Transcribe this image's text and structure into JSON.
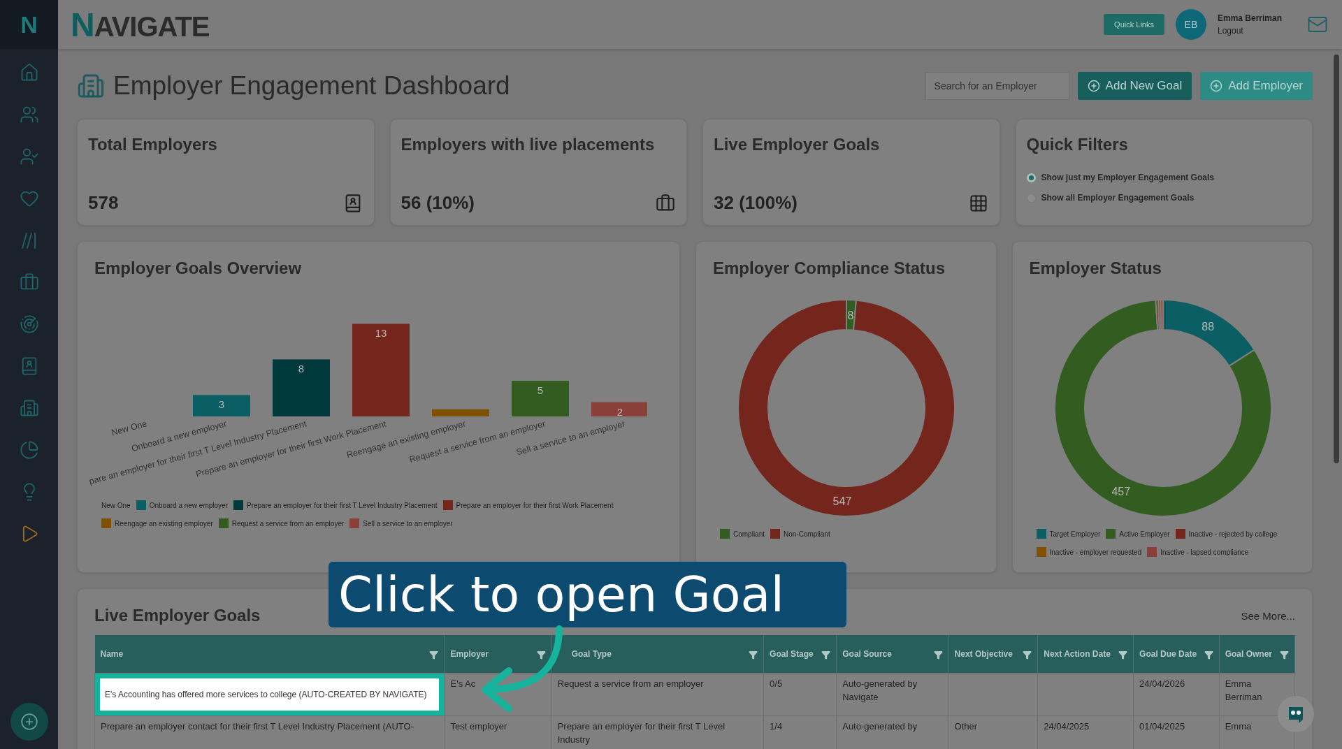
{
  "brand": {
    "logo": "NAVIGATE",
    "sidebar_mark": "N"
  },
  "header": {
    "quick_links": "Quick Links",
    "user": {
      "initials": "EB",
      "name": "Emma Berriman",
      "logout": "Logout"
    }
  },
  "sidebar": {
    "items": [
      {
        "kind": "home"
      },
      {
        "kind": "users"
      },
      {
        "kind": "user-tag"
      },
      {
        "kind": "heart"
      },
      {
        "kind": "slashes"
      },
      {
        "kind": "briefcase"
      },
      {
        "kind": "radar"
      },
      {
        "kind": "contact"
      },
      {
        "kind": "building"
      },
      {
        "kind": "pie"
      },
      {
        "kind": "bulb"
      },
      {
        "kind": "play"
      }
    ]
  },
  "page": {
    "title": "Employer Engagement Dashboard",
    "search": {
      "placeholder": "Search for an Employer"
    },
    "buttons": [
      "Add New Goal",
      "Add Employer"
    ]
  },
  "stats": [
    {
      "label": "Total Employers",
      "value": "578",
      "kind": "contact"
    },
    {
      "label": "Employers with live placements",
      "value": "56 (10%)",
      "kind": "briefcase"
    },
    {
      "label": "Live Employer Goals",
      "value": "32 (100%)",
      "kind": "grid"
    }
  ],
  "quick_filters": {
    "title": "Quick Filters",
    "options": [
      {
        "label": "Show just my Employer Engagement Goals",
        "selected": true
      },
      {
        "label": "Show all Employer Engagement Goals",
        "selected": false
      }
    ]
  },
  "goals_overview": {
    "title": "Employer Goals Overview",
    "chart_data": {
      "type": "bar",
      "categories": [
        "New One",
        "Onboard a new employer",
        "pare an employer for their first T Level Industry Placement",
        "Prepare an employer for their first Work Placement",
        "Reengage an existing employer",
        "Request a service from an employer",
        "Sell a service to an employer"
      ],
      "values": [
        0,
        3,
        8,
        13,
        1,
        5,
        2
      ],
      "value_labels": [
        null,
        "3",
        "8",
        "13",
        null,
        "5",
        "2"
      ]
    },
    "legend": [
      {
        "label": "New One"
      },
      {
        "label": "Onboard a new employer",
        "color": "#0b5e63"
      },
      {
        "label": "Prepare an employer for their first T Level Industry Placement",
        "color": "#003a3d"
      },
      {
        "label": "Prepare an employer for their first Work Placement",
        "color": "#74261d"
      },
      {
        "label": "Reengage an existing employer",
        "color": "#7f5100"
      },
      {
        "label": "Request a service from an employer",
        "color": "#335c20"
      },
      {
        "label": "Sell a service to an employer",
        "color": "#8a4038"
      }
    ]
  },
  "compliance": {
    "title": "Employer Compliance Status",
    "chart_data": {
      "type": "donut",
      "categories": [
        "Compliant",
        "Non-Compliant"
      ],
      "values": [
        8,
        547
      ],
      "colors": [
        "#335c20",
        "#74261d"
      ],
      "value_labels": [
        "8",
        "547"
      ]
    }
  },
  "employer_status": {
    "title": "Employer Status",
    "chart_data": {
      "type": "donut",
      "categories": [
        "Target Employer",
        "Active Employer",
        "Inactive - rejected by college",
        "Inactive - employer requested",
        "Inactive - lapsed compliance"
      ],
      "values": [
        88,
        457,
        2,
        2,
        2
      ],
      "colors": [
        "#0b5e63",
        "#335c20",
        "#74261d",
        "#7f5100",
        "#8a4038"
      ],
      "value_labels": [
        "88",
        "457",
        null,
        null,
        null
      ]
    }
  },
  "live_goals": {
    "title": "Live Employer Goals",
    "see_more": "See More...",
    "columns": [
      "Name",
      "Employer",
      "Goal Type",
      "Goal Stage",
      "Goal Source",
      "Next Objective",
      "Next Action Date",
      "Goal Due Date",
      "Goal Owner"
    ],
    "rows": [
      {
        "highlighted": true,
        "cells": [
          "E's Accounting has offered more services to college (AUTO-CREATED BY NAVIGATE)",
          "E's Ac",
          "Request a service from an employer",
          "0/5",
          "Auto-generated by Navigate",
          null,
          null,
          "24/04/2026",
          "Emma Berriman"
        ]
      },
      {
        "highlighted": false,
        "cells": [
          "Prepare an employer contact for their first T Level Industry Placement (AUTO-",
          "Test employer",
          "Prepare an employer for their first T Level Industry",
          "1/4",
          "Auto-generated by",
          "Other",
          "24/04/2025",
          "01/04/2025",
          "Emma"
        ]
      }
    ]
  },
  "callout": {
    "text": "Click to open Goal"
  }
}
